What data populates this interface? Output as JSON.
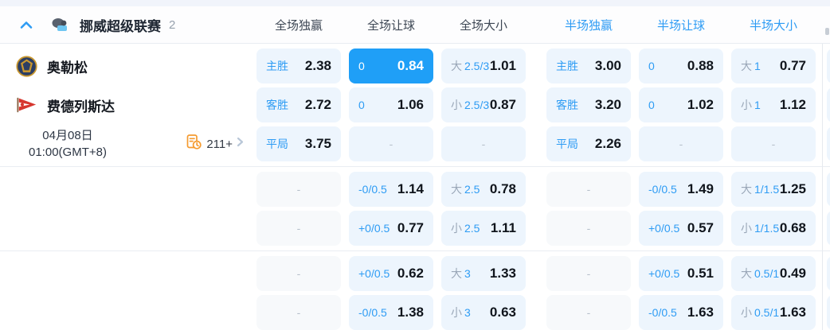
{
  "header": {
    "league_name": "挪威超级联赛",
    "match_count": "2",
    "columns": [
      {
        "label": "全场独赢",
        "half": false
      },
      {
        "label": "全场让球",
        "half": false
      },
      {
        "label": "全场大小",
        "half": false
      },
      {
        "label": "半场独赢",
        "half": true
      },
      {
        "label": "半场让球",
        "half": true
      },
      {
        "label": "半场大小",
        "half": true
      }
    ]
  },
  "match": {
    "home_team": "奥勒松",
    "away_team": "费德列斯达",
    "date": "04月08日",
    "time": "01:00(GMT+8)",
    "markets_count": "211+"
  },
  "colors": {
    "accent_blue": "#2e9cf4",
    "highlight_cell": "#1f9ff7",
    "cell_bg": "#edf5fd",
    "muted_gray": "#9aa7b8"
  },
  "groups": [
    {
      "rows": [
        {
          "left": "home",
          "cells": [
            {
              "t": "odds",
              "label": "主胜",
              "value": "2.38"
            },
            {
              "t": "hcp",
              "label": "0",
              "value": "0.84",
              "highlight": true
            },
            {
              "t": "ou",
              "prefix": "大",
              "line": "2.5/3",
              "value": "1.01"
            },
            {
              "t": "odds",
              "label": "主胜",
              "value": "3.00"
            },
            {
              "t": "hcp",
              "label": "0",
              "value": "0.88"
            },
            {
              "t": "ou",
              "prefix": "大",
              "line": "1",
              "value": "0.77"
            }
          ]
        },
        {
          "left": "away",
          "cells": [
            {
              "t": "odds",
              "label": "客胜",
              "value": "2.72"
            },
            {
              "t": "hcp",
              "label": "0",
              "value": "1.06"
            },
            {
              "t": "ou",
              "prefix": "小",
              "line": "2.5/3",
              "value": "0.87"
            },
            {
              "t": "odds",
              "label": "客胜",
              "value": "3.20"
            },
            {
              "t": "hcp",
              "label": "0",
              "value": "1.02"
            },
            {
              "t": "ou",
              "prefix": "小",
              "line": "1",
              "value": "1.12"
            }
          ]
        },
        {
          "left": "date",
          "cells": [
            {
              "t": "odds",
              "label": "平局",
              "value": "3.75"
            },
            {
              "t": "dash"
            },
            {
              "t": "dash"
            },
            {
              "t": "odds",
              "label": "平局",
              "value": "2.26"
            },
            {
              "t": "dash"
            },
            {
              "t": "dash"
            }
          ]
        }
      ]
    },
    {
      "rows": [
        {
          "left": "none",
          "cells": [
            {
              "t": "empty"
            },
            {
              "t": "hcp",
              "label": "-0/0.5",
              "value": "1.14"
            },
            {
              "t": "ou",
              "prefix": "大",
              "line": "2.5",
              "value": "0.78"
            },
            {
              "t": "empty"
            },
            {
              "t": "hcp",
              "label": "-0/0.5",
              "value": "1.49"
            },
            {
              "t": "ou",
              "prefix": "大",
              "line": "1/1.5",
              "value": "1.25"
            }
          ]
        },
        {
          "left": "none",
          "cells": [
            {
              "t": "empty"
            },
            {
              "t": "hcp",
              "label": "+0/0.5",
              "value": "0.77"
            },
            {
              "t": "ou",
              "prefix": "小",
              "line": "2.5",
              "value": "1.11"
            },
            {
              "t": "empty"
            },
            {
              "t": "hcp",
              "label": "+0/0.5",
              "value": "0.57"
            },
            {
              "t": "ou",
              "prefix": "小",
              "line": "1/1.5",
              "value": "0.68"
            }
          ]
        }
      ]
    },
    {
      "rows": [
        {
          "left": "none",
          "cells": [
            {
              "t": "empty"
            },
            {
              "t": "hcp",
              "label": "+0/0.5",
              "value": "0.62"
            },
            {
              "t": "ou",
              "prefix": "大",
              "line": "3",
              "value": "1.33"
            },
            {
              "t": "empty"
            },
            {
              "t": "hcp",
              "label": "+0/0.5",
              "value": "0.51"
            },
            {
              "t": "ou",
              "prefix": "大",
              "line": "0.5/1",
              "value": "0.49"
            }
          ]
        },
        {
          "left": "none",
          "cells": [
            {
              "t": "empty"
            },
            {
              "t": "hcp",
              "label": "-0/0.5",
              "value": "1.38"
            },
            {
              "t": "ou",
              "prefix": "小",
              "line": "3",
              "value": "0.63"
            },
            {
              "t": "empty"
            },
            {
              "t": "hcp",
              "label": "-0/0.5",
              "value": "1.63"
            },
            {
              "t": "ou",
              "prefix": "小",
              "line": "0.5/1",
              "value": "1.63"
            }
          ]
        }
      ]
    }
  ]
}
